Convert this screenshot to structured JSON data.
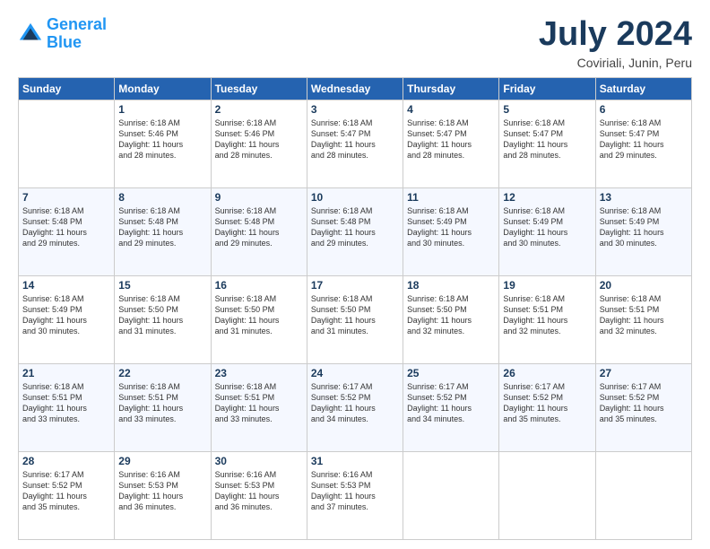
{
  "logo": {
    "line1": "General",
    "line2": "Blue"
  },
  "header": {
    "month": "July 2024",
    "location": "Coviriali, Junin, Peru"
  },
  "days_of_week": [
    "Sunday",
    "Monday",
    "Tuesday",
    "Wednesday",
    "Thursday",
    "Friday",
    "Saturday"
  ],
  "weeks": [
    [
      {
        "day": "",
        "info": ""
      },
      {
        "day": "1",
        "info": "Sunrise: 6:18 AM\nSunset: 5:46 PM\nDaylight: 11 hours\nand 28 minutes."
      },
      {
        "day": "2",
        "info": "Sunrise: 6:18 AM\nSunset: 5:46 PM\nDaylight: 11 hours\nand 28 minutes."
      },
      {
        "day": "3",
        "info": "Sunrise: 6:18 AM\nSunset: 5:47 PM\nDaylight: 11 hours\nand 28 minutes."
      },
      {
        "day": "4",
        "info": "Sunrise: 6:18 AM\nSunset: 5:47 PM\nDaylight: 11 hours\nand 28 minutes."
      },
      {
        "day": "5",
        "info": "Sunrise: 6:18 AM\nSunset: 5:47 PM\nDaylight: 11 hours\nand 28 minutes."
      },
      {
        "day": "6",
        "info": "Sunrise: 6:18 AM\nSunset: 5:47 PM\nDaylight: 11 hours\nand 29 minutes."
      }
    ],
    [
      {
        "day": "7",
        "info": "Sunrise: 6:18 AM\nSunset: 5:48 PM\nDaylight: 11 hours\nand 29 minutes."
      },
      {
        "day": "8",
        "info": "Sunrise: 6:18 AM\nSunset: 5:48 PM\nDaylight: 11 hours\nand 29 minutes."
      },
      {
        "day": "9",
        "info": "Sunrise: 6:18 AM\nSunset: 5:48 PM\nDaylight: 11 hours\nand 29 minutes."
      },
      {
        "day": "10",
        "info": "Sunrise: 6:18 AM\nSunset: 5:48 PM\nDaylight: 11 hours\nand 29 minutes."
      },
      {
        "day": "11",
        "info": "Sunrise: 6:18 AM\nSunset: 5:49 PM\nDaylight: 11 hours\nand 30 minutes."
      },
      {
        "day": "12",
        "info": "Sunrise: 6:18 AM\nSunset: 5:49 PM\nDaylight: 11 hours\nand 30 minutes."
      },
      {
        "day": "13",
        "info": "Sunrise: 6:18 AM\nSunset: 5:49 PM\nDaylight: 11 hours\nand 30 minutes."
      }
    ],
    [
      {
        "day": "14",
        "info": "Sunrise: 6:18 AM\nSunset: 5:49 PM\nDaylight: 11 hours\nand 30 minutes."
      },
      {
        "day": "15",
        "info": "Sunrise: 6:18 AM\nSunset: 5:50 PM\nDaylight: 11 hours\nand 31 minutes."
      },
      {
        "day": "16",
        "info": "Sunrise: 6:18 AM\nSunset: 5:50 PM\nDaylight: 11 hours\nand 31 minutes."
      },
      {
        "day": "17",
        "info": "Sunrise: 6:18 AM\nSunset: 5:50 PM\nDaylight: 11 hours\nand 31 minutes."
      },
      {
        "day": "18",
        "info": "Sunrise: 6:18 AM\nSunset: 5:50 PM\nDaylight: 11 hours\nand 32 minutes."
      },
      {
        "day": "19",
        "info": "Sunrise: 6:18 AM\nSunset: 5:51 PM\nDaylight: 11 hours\nand 32 minutes."
      },
      {
        "day": "20",
        "info": "Sunrise: 6:18 AM\nSunset: 5:51 PM\nDaylight: 11 hours\nand 32 minutes."
      }
    ],
    [
      {
        "day": "21",
        "info": "Sunrise: 6:18 AM\nSunset: 5:51 PM\nDaylight: 11 hours\nand 33 minutes."
      },
      {
        "day": "22",
        "info": "Sunrise: 6:18 AM\nSunset: 5:51 PM\nDaylight: 11 hours\nand 33 minutes."
      },
      {
        "day": "23",
        "info": "Sunrise: 6:18 AM\nSunset: 5:51 PM\nDaylight: 11 hours\nand 33 minutes."
      },
      {
        "day": "24",
        "info": "Sunrise: 6:17 AM\nSunset: 5:52 PM\nDaylight: 11 hours\nand 34 minutes."
      },
      {
        "day": "25",
        "info": "Sunrise: 6:17 AM\nSunset: 5:52 PM\nDaylight: 11 hours\nand 34 minutes."
      },
      {
        "day": "26",
        "info": "Sunrise: 6:17 AM\nSunset: 5:52 PM\nDaylight: 11 hours\nand 35 minutes."
      },
      {
        "day": "27",
        "info": "Sunrise: 6:17 AM\nSunset: 5:52 PM\nDaylight: 11 hours\nand 35 minutes."
      }
    ],
    [
      {
        "day": "28",
        "info": "Sunrise: 6:17 AM\nSunset: 5:52 PM\nDaylight: 11 hours\nand 35 minutes."
      },
      {
        "day": "29",
        "info": "Sunrise: 6:16 AM\nSunset: 5:53 PM\nDaylight: 11 hours\nand 36 minutes."
      },
      {
        "day": "30",
        "info": "Sunrise: 6:16 AM\nSunset: 5:53 PM\nDaylight: 11 hours\nand 36 minutes."
      },
      {
        "day": "31",
        "info": "Sunrise: 6:16 AM\nSunset: 5:53 PM\nDaylight: 11 hours\nand 37 minutes."
      },
      {
        "day": "",
        "info": ""
      },
      {
        "day": "",
        "info": ""
      },
      {
        "day": "",
        "info": ""
      }
    ]
  ]
}
